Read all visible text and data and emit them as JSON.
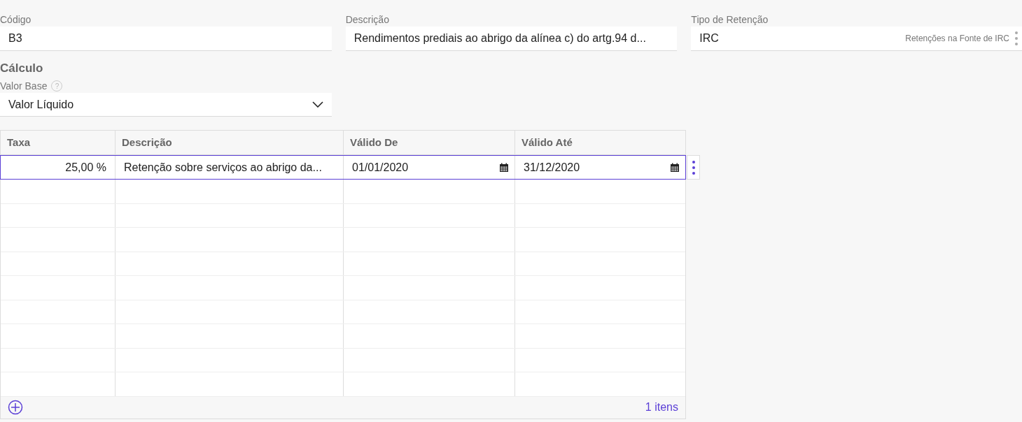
{
  "fields": [
    {
      "label": "Código",
      "value": "B3"
    },
    {
      "label": "Descrição",
      "value": "Rendimentos prediais ao abrigo da alínea c) do artg.94 d..."
    },
    {
      "label": "Tipo de Retenção",
      "value": "IRC",
      "hint": "Retenções na Fonte de IRC"
    }
  ],
  "section_title": "Cálculo",
  "valor_base": {
    "label": "Valor Base",
    "help": "?",
    "value": "Valor Líquido"
  },
  "table": {
    "columns": [
      "Taxa",
      "Descrição",
      "Válido De",
      "Válido Até"
    ],
    "rows": [
      {
        "selected": true,
        "taxa": "25,00 %",
        "descricao": "Retenção sobre serviços ao abrigo da...",
        "valido_de": "01/01/2020",
        "valido_ate": "31/12/2020"
      }
    ],
    "count": "1 itens"
  }
}
